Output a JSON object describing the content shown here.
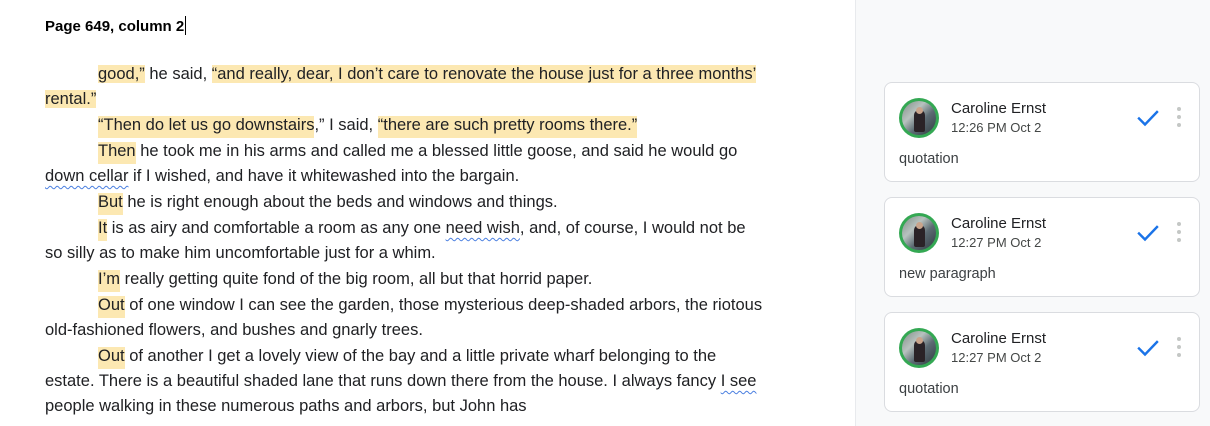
{
  "document": {
    "heading": "Page 649, column 2",
    "p1_a": "good,”",
    "p1_b": " he said, ",
    "p1_c": "“and really, dear, I don’t care to renovate the house just for a three months’ rental.”",
    "p2_a": "“Then do let us go downstairs",
    "p2_b": ",” I said, ",
    "p2_c": "“there are such pretty rooms there.”",
    "p3_a": "Then",
    "p3_b": " he took me in his arms and called me a blessed little goose, and said he would go ",
    "p3_c": "down cellar",
    "p3_d": " if I wished, and have it whitewashed into the bargain.",
    "p4_a": "But",
    "p4_b": " he is right enough about the beds and windows and things.",
    "p5_a": "It",
    "p5_b": " is as airy and comfortable a room as any one ",
    "p5_c": "need wish",
    "p5_d": ", and, of course, I would not be so silly as to make him uncomfortable just for a whim.",
    "p6_a": "I’m",
    "p6_b": " really getting quite fond of the big room, all but that horrid paper.",
    "p7_a": "Out",
    "p7_b": " of one window I can see the garden, those mysterious deep-shaded arbors, the riotous old-fashioned flowers, and bushes and gnarly trees.",
    "p8_a": "Out",
    "p8_b": " of another I get a lovely view of the bay and a little private wharf belonging to the estate. There is a beautiful shaded lane that runs down there from the house. I always fancy ",
    "p8_c": "I see",
    "p8_d": " people walking in these numerous paths and arbors, but John has"
  },
  "comments": [
    {
      "author": "Caroline Ernst",
      "time": "12:26 PM Oct 2",
      "text": "quotation"
    },
    {
      "author": "Caroline Ernst",
      "time": "12:27 PM Oct 2",
      "text": "new paragraph"
    },
    {
      "author": "Caroline Ernst",
      "time": "12:27 PM Oct 2",
      "text": "quotation"
    }
  ],
  "colors": {
    "highlight": "#fce8b2",
    "resolve_check": "#1a73e8",
    "avatar_ring": "#34a853",
    "sidebar_bg": "#f8f9fa"
  },
  "icons": [
    "avatar",
    "resolve-check-icon",
    "more-options-icon"
  ]
}
